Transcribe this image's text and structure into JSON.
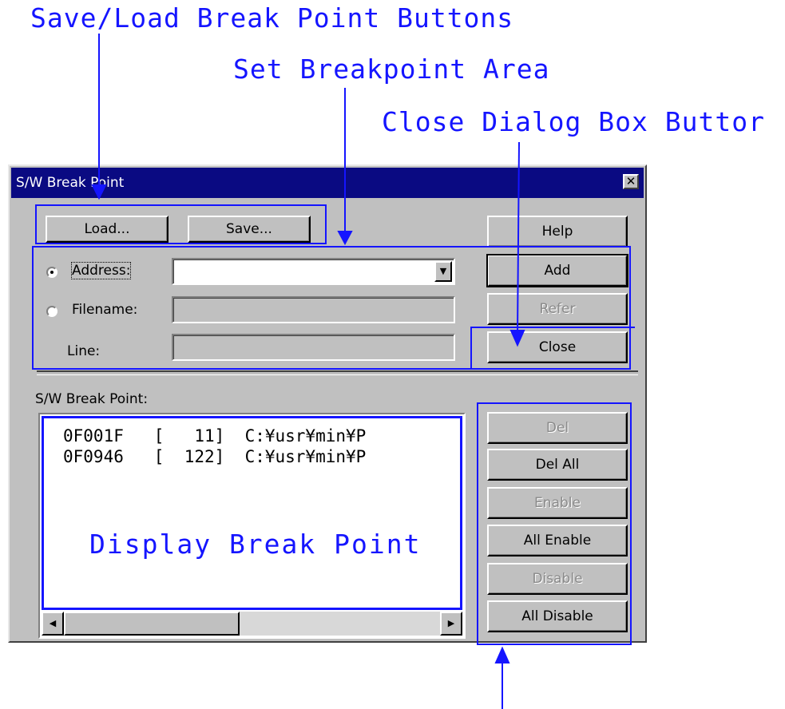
{
  "annotations": {
    "save_load": "Save/Load Break Point Buttons",
    "set_area": "Set Breakpoint Area",
    "close_button": "Close Dialog Box Buttor",
    "display": "Display Break Point"
  },
  "dialog": {
    "title": "S/W Break Point",
    "close_glyph": "✕",
    "buttons": {
      "load": "Load...",
      "save": "Save...",
      "help": "Help",
      "add": "Add",
      "refer": "Refer",
      "close": "Close"
    },
    "address_label": "Address:",
    "filename_label": "Filename:",
    "line_label": "Line:",
    "address_value": "",
    "filename_value": "",
    "line_value": "",
    "list_label": "S/W Break Point:",
    "list_rows": [
      "0F001F   [   11]  C:¥usr¥min¥P",
      "0F0946   [  122]  C:¥usr¥min¥P"
    ],
    "side_buttons": {
      "del": "Del",
      "del_all": "Del All",
      "enable": "Enable",
      "all_enable": "All Enable",
      "disable": "Disable",
      "all_disable": "All Disable"
    }
  },
  "icons": {
    "dropdown": "chevron-down-icon",
    "scroll_left": "arrow-left-icon",
    "scroll_right": "arrow-right-icon",
    "window_close": "close-icon"
  },
  "colors": {
    "annotation": "#1515ff",
    "titlebar": "#0a0a82",
    "dialog_face": "#c0c0c0"
  }
}
